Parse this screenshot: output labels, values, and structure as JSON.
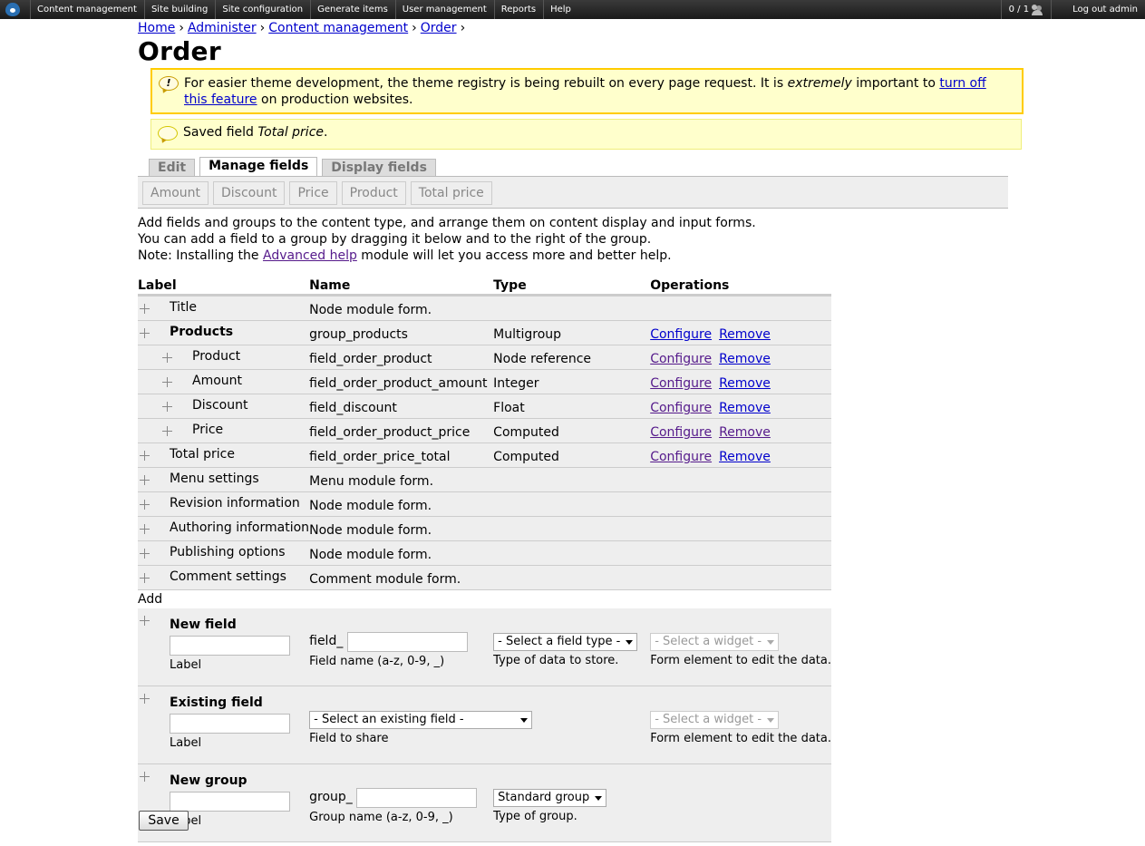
{
  "toolbar": {
    "menu": [
      "Content management",
      "Site building",
      "Site configuration",
      "Generate items",
      "User management",
      "Reports",
      "Help"
    ],
    "user_count": "0 / 1",
    "logout": "Log out admin"
  },
  "breadcrumb": [
    "Home",
    "Administer",
    "Content management",
    "Order"
  ],
  "page_title": "Order",
  "warning": {
    "text_before": "For easier theme development, the theme registry is being rebuilt on every page request. It is ",
    "emphasis": "extremely",
    "text_middle": " important to ",
    "link": "turn off this feature",
    "text_after": " on production websites."
  },
  "status": {
    "text_before": "Saved field ",
    "emphasis": "Total price",
    "text_after": "."
  },
  "tabs": [
    "Edit",
    "Manage fields",
    "Display fields"
  ],
  "subtabs": [
    "Amount",
    "Discount",
    "Price",
    "Product",
    "Total price"
  ],
  "help": {
    "line1": "Add fields and groups to the content type, and arrange them on content display and input forms.",
    "line2": "You can add a field to a group by dragging it below and to the right of the group.",
    "line3_before": "Note: Installing the ",
    "line3_link": "Advanced help",
    "line3_after": " module will let you access more and better help."
  },
  "table": {
    "headers": [
      "Label",
      "Name",
      "Type",
      "Operations"
    ],
    "rows": [
      {
        "label": "Title",
        "name": "Node module form.",
        "type": "",
        "configure": "",
        "remove": ""
      },
      {
        "label": "Products",
        "name": "group_products",
        "type": "Multigroup",
        "configure": "Configure",
        "remove": "Remove"
      },
      {
        "label": "Product",
        "name": "field_order_product",
        "type": "Node reference",
        "configure": "Configure",
        "remove": "Remove"
      },
      {
        "label": "Amount",
        "name": "field_order_product_amount",
        "type": "Integer",
        "configure": "Configure",
        "remove": "Remove"
      },
      {
        "label": "Discount",
        "name": "field_discount",
        "type": "Float",
        "configure": "Configure",
        "remove": "Remove"
      },
      {
        "label": "Price",
        "name": "field_order_product_price",
        "type": "Computed",
        "configure": "Configure",
        "remove": "Remove"
      },
      {
        "label": "Total price",
        "name": "field_order_price_total",
        "type": "Computed",
        "configure": "Configure",
        "remove": "Remove"
      },
      {
        "label": "Menu settings",
        "name": "Menu module form.",
        "type": "",
        "configure": "",
        "remove": ""
      },
      {
        "label": "Revision information",
        "name": "Node module form.",
        "type": "",
        "configure": "",
        "remove": ""
      },
      {
        "label": "Authoring information",
        "name": "Node module form.",
        "type": "",
        "configure": "",
        "remove": ""
      },
      {
        "label": "Publishing options",
        "name": "Node module form.",
        "type": "",
        "configure": "",
        "remove": ""
      },
      {
        "label": "Comment settings",
        "name": "Comment module form.",
        "type": "",
        "configure": "",
        "remove": ""
      }
    ],
    "add_label": "Add",
    "new_field": {
      "title": "New field",
      "label_desc": "Label",
      "prefix": "field_",
      "name_desc": "Field name (a-z, 0-9, _)",
      "type_select": "- Select a field type -",
      "type_desc": "Type of data to store.",
      "widget_select": "- Select a widget -",
      "widget_desc": "Form element to edit the data."
    },
    "existing_field": {
      "title": "Existing field",
      "label_desc": "Label",
      "field_select": "- Select an existing field -",
      "field_desc": "Field to share",
      "widget_select": "- Select a widget -",
      "widget_desc": "Form element to edit the data."
    },
    "new_group": {
      "title": "New group",
      "label_desc": "Label",
      "prefix": "group_",
      "name_desc": "Group name (a-z, 0-9, _)",
      "type_select": "Standard group",
      "type_desc": "Type of group."
    }
  },
  "save_label": "Save"
}
